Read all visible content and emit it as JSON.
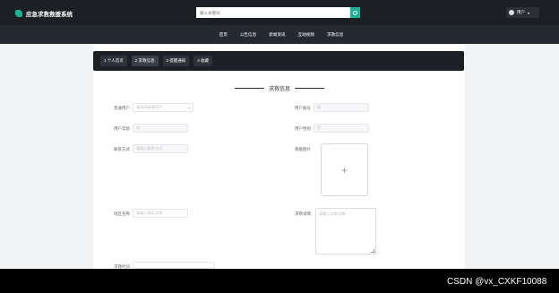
{
  "app": {
    "title": "应急求救救援系统"
  },
  "search": {
    "placeholder": "输入关键词"
  },
  "user": {
    "name": "用户"
  },
  "nav": {
    "items": [
      "首页",
      "公告信息",
      "新闻资讯",
      "互助视频",
      "求救信息"
    ]
  },
  "tabs": {
    "items": [
      "1 个人首页",
      "2 求救信息",
      "3 提醒通知",
      "4 收藏"
    ]
  },
  "section": {
    "title": "求救信息"
  },
  "form": {
    "fields": {
      "user_select": {
        "label": "普通用户",
        "placeholder": "请选择普通用户"
      },
      "user_account": {
        "label": "用户账号",
        "placeholder": "账"
      },
      "user_age": {
        "label": "用户年龄",
        "placeholder": "年"
      },
      "user_gender": {
        "label": "用户性别",
        "placeholder": "性"
      },
      "contact": {
        "label": "联系方式",
        "placeholder": "请输入联系方式"
      },
      "rescue_image": {
        "label": "救援图片"
      },
      "location": {
        "label": "地区名称",
        "placeholder": "请输入地区名称"
      },
      "details": {
        "label": "求救详情",
        "placeholder": "请输入求救详情"
      },
      "rescue_time": {
        "label": "求救时间",
        "placeholder": ""
      }
    }
  },
  "footer": {
    "watermark": "CSDN @vx_CXKF10088"
  },
  "colors": {
    "accent": "#1ab394",
    "topbar": "#1c1f24",
    "navbar": "#252932"
  }
}
